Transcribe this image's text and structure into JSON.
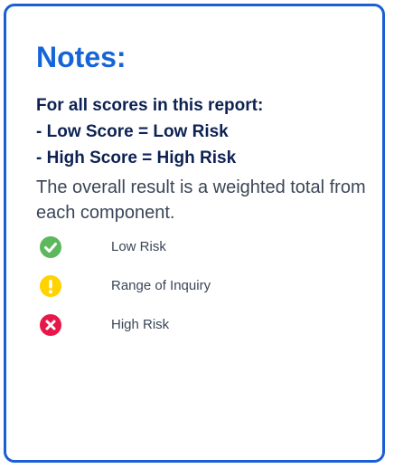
{
  "notes": {
    "title": "Notes:",
    "lines": [
      "For all scores in this report:",
      "- Low Score = Low Risk",
      "- High Score = High Risk"
    ],
    "description": "The overall result is a weighted total from each component."
  },
  "legend": [
    {
      "icon": "check-circle-icon",
      "color": "#5cb85c",
      "label": "Low Risk"
    },
    {
      "icon": "exclamation-circle-icon",
      "color": "#ffd200",
      "label": "Range of Inquiry"
    },
    {
      "icon": "x-circle-icon",
      "color": "#e8174a",
      "label": "High Risk"
    }
  ],
  "colors": {
    "border": "#1a5fd6",
    "title": "#1565d8",
    "heading_text": "#0d2253",
    "body_text": "#3a4658"
  }
}
